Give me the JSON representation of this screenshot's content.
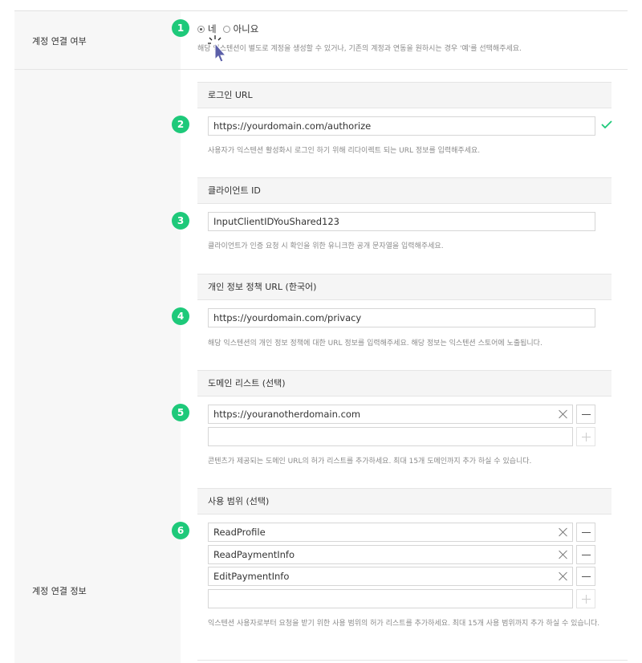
{
  "rows": {
    "link_label": "계정 연결 여부",
    "info_label": "계정 연결 정보"
  },
  "badges": [
    "1",
    "2",
    "3",
    "4",
    "5",
    "6"
  ],
  "link": {
    "yes_label": "네",
    "no_label": "아니요",
    "selected": "yes",
    "help": "해당 익스텐션이 별도로 계정을 생성할 수 있거나, 기존의 계정과 연동을 원하시는 경우 '예'를 선택해주세요."
  },
  "login_url": {
    "title": "로그인 URL",
    "value": "https://yourdomain.com/authorize",
    "help": "사용자가 익스텐션 활성화시 로그인 하기 위해 리다이렉트 되는 URL 정보를 입력해주세요."
  },
  "client_id": {
    "title": "클라이언트 ID",
    "value": "InputClientIDYouShared123",
    "help": "클라이언트가 인증 요청 시 확인을 위한 유니크한 공개 문자열을 입력해주세요."
  },
  "privacy_url": {
    "title": "개인 정보 정책 URL (한국어)",
    "value": "https://yourdomain.com/privacy",
    "help": "해당 익스텐션의 개인 정보 정책에 대한 URL 정보를 입력해주세요. 해당 정보는 익스텐션 스토어에 노출됩니다."
  },
  "domains": {
    "title": "도메인 리스트 (선택)",
    "items": [
      "https://youranotherdomain.com"
    ],
    "help": "콘텐츠가 제공되는 도메인 URL의 허가 리스트를 추가하세요. 최대 15개 도메인까지 추가 하실 수 있습니다."
  },
  "scopes": {
    "title": "사용 범위 (선택)",
    "items": [
      "ReadProfile",
      "ReadPaymentInfo",
      "EditPaymentInfo"
    ],
    "help": "익스텐션 사용자로부터 요청을 받기 위한 사용 범위의 허가 리스트를 추가하세요. 최대 15개 사용 범위까지 추가 하실 수 있습니다."
  },
  "colors": {
    "badge": "#1ec97a",
    "check": "#1ec97a",
    "label_bg": "#f7f7f7"
  }
}
